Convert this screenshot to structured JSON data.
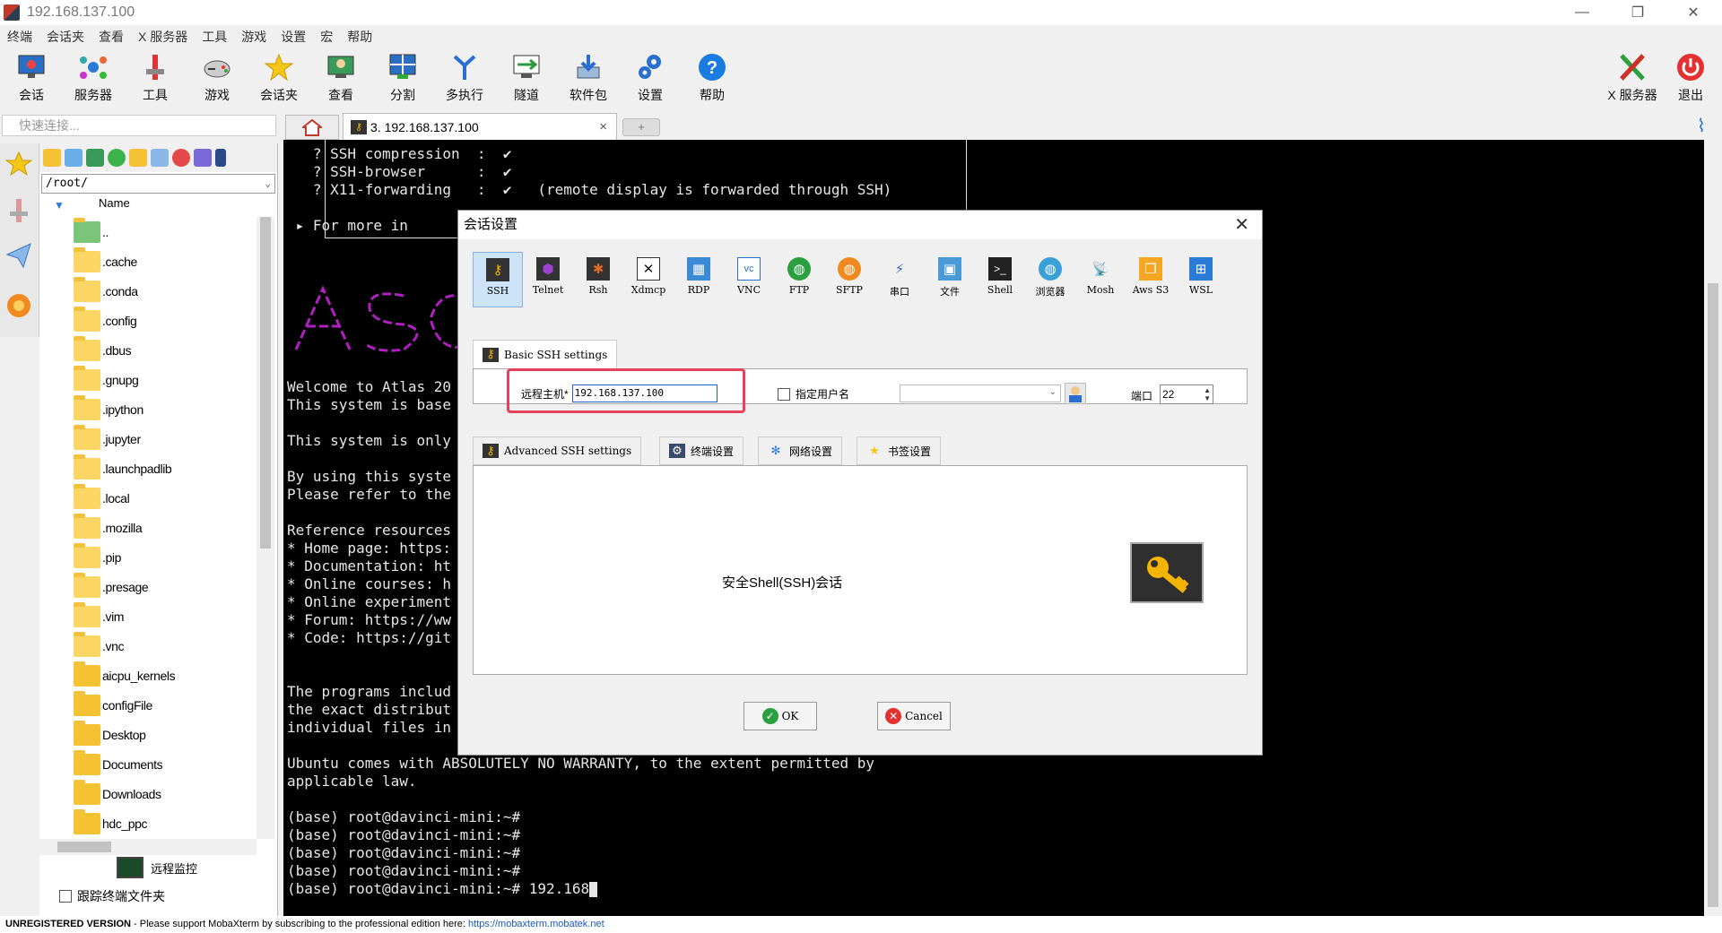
{
  "window": {
    "title": "192.168.137.100"
  },
  "menu": [
    "终端",
    "会话夹",
    "查看",
    "X 服务器",
    "工具",
    "游戏",
    "设置",
    "宏",
    "帮助"
  ],
  "toolbar": {
    "buttons": [
      "会话",
      "服务器",
      "工具",
      "游戏",
      "会话夹",
      "查看",
      "分割",
      "多执行",
      "隧道",
      "软件包",
      "设置",
      "帮助"
    ],
    "xserver": "X 服务器",
    "exit": "退出"
  },
  "quick_connect": {
    "placeholder": "快速连接..."
  },
  "tabs": {
    "session": "3. 192.168.137.100",
    "close": "×",
    "new": "+"
  },
  "file_browser": {
    "path": "/root/",
    "column": "Name",
    "items": [
      "..",
      ".cache",
      ".conda",
      ".config",
      ".dbus",
      ".gnupg",
      ".ipython",
      ".jupyter",
      ".launchpadlib",
      ".local",
      ".mozilla",
      ".pip",
      ".presage",
      ".vim",
      ".vnc",
      "aicpu_kernels",
      "configFile",
      "Desktop",
      "Documents",
      "Downloads",
      "hdc_ppc"
    ],
    "remote_monitor": "远程监控",
    "follow_folder": "跟踪终端文件夹"
  },
  "terminal": {
    "lines": [
      "   ? SSH compression  :  ✔",
      "   ? SSH-browser      :  ✔",
      "   ? X11-forwarding   :  ✔   (remote display is forwarded through SSH)",
      "",
      " ▸ For more in",
      "Welcome to Atlas 20",
      "This system is base",
      "",
      "This system is only",
      "",
      "By using this syste",
      "Please refer to the",
      "",
      "Reference resources",
      "* Home page: https:",
      "* Documentation: ht",
      "* Online courses: h",
      "* Online experiment",
      "* Forum: https://ww",
      "* Code: https://git",
      "",
      "",
      "The programs includ",
      "the exact distribut",
      "individual files in",
      "",
      "Ubuntu comes with ABSOLUTELY NO WARRANTY, to the extent permitted by",
      "applicable law.",
      "",
      "(base) root@davinci-mini:~#",
      "(base) root@davinci-mini:~#",
      "(base) root@davinci-mini:~#",
      "(base) root@davinci-mini:~#",
      "(base) root@davinci-mini:~# 192.168"
    ]
  },
  "status_bar": {
    "label": "UNREGISTERED VERSION",
    "text": " -  Please support MobaXterm by subscribing to the professional edition here: ",
    "url": "https://mobaxterm.mobatek.net"
  },
  "dialog": {
    "title": "会话设置",
    "close": "✕",
    "session_types": [
      "SSH",
      "Telnet",
      "Rsh",
      "Xdmcp",
      "RDP",
      "VNC",
      "FTP",
      "SFTP",
      "串口",
      "文件",
      "Shell",
      "浏览器",
      "Mosh",
      "Aws S3",
      "WSL"
    ],
    "basic_tab": "Basic SSH settings",
    "remote_host_label": "远程主机*",
    "remote_host_value": "192.168.137.100",
    "specify_user_label": "指定用户名",
    "port_label": "端口",
    "port_value": "22",
    "sub_tabs": [
      "Advanced SSH settings",
      "终端设置",
      "网络设置",
      "书签设置"
    ],
    "description": "安全Shell(SSH)会话",
    "ok": "OK",
    "cancel": "Cancel"
  },
  "colors": {
    "accent": "#2b7bd6",
    "highlight": "#e8405a",
    "terminal_bg": "#000000"
  }
}
